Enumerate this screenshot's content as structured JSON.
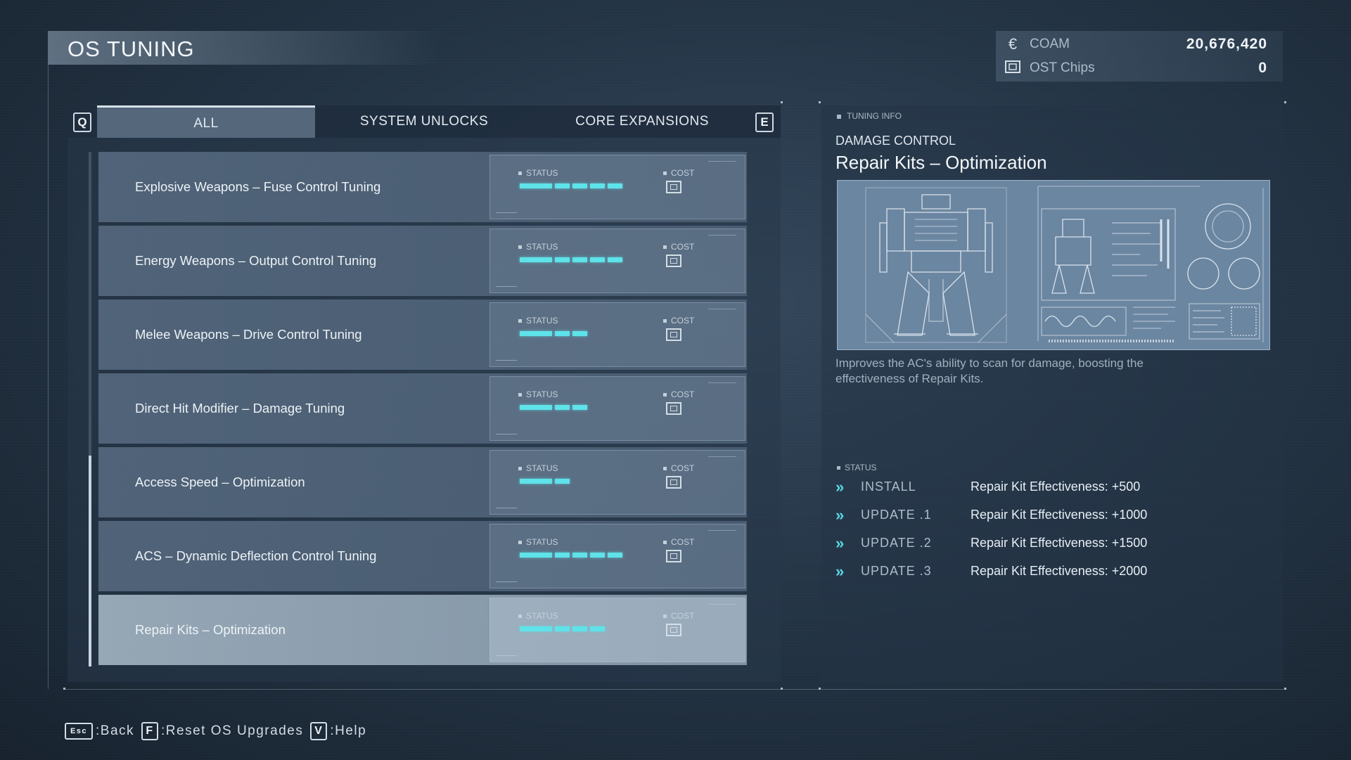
{
  "screen": {
    "title": "OS TUNING"
  },
  "currency": {
    "coam_label": "COAM",
    "coam_value": "20,676,420",
    "ost_label": "OST Chips",
    "ost_value": "0"
  },
  "tabs": {
    "prev_key": "Q",
    "next_key": "E",
    "items": [
      {
        "label": "ALL",
        "active": true
      },
      {
        "label": "SYSTEM UNLOCKS",
        "active": false
      },
      {
        "label": "CORE EXPANSIONS",
        "active": false
      }
    ]
  },
  "list": {
    "status_label": "STATUS",
    "cost_label": "COST",
    "items": [
      {
        "name": "Explosive Weapons – Fuse Control Tuning",
        "level": 4,
        "selected": false
      },
      {
        "name": "Energy Weapons – Output Control Tuning",
        "level": 4,
        "selected": false
      },
      {
        "name": "Melee Weapons – Drive Control Tuning",
        "level": 2,
        "selected": false
      },
      {
        "name": "Direct Hit Modifier – Damage Tuning",
        "level": 2,
        "selected": false
      },
      {
        "name": "Access Speed – Optimization",
        "level": 1,
        "selected": false
      },
      {
        "name": "ACS – Dynamic Deflection Control Tuning",
        "level": 4,
        "selected": false
      },
      {
        "name": "Repair Kits – Optimization",
        "level": 3,
        "selected": true
      }
    ]
  },
  "tuning_info": {
    "header": "TUNING INFO",
    "category": "DAMAGE CONTROL",
    "title": "Repair Kits – Optimization",
    "description": "Improves the AC's ability to scan for damage, boosting the effectiveness of Repair Kits.",
    "status_label": "STATUS",
    "updates": [
      {
        "level": "INSTALL",
        "effect": "Repair Kit Effectiveness: +500"
      },
      {
        "level": "UPDATE .1",
        "effect": "Repair Kit Effectiveness: +1000"
      },
      {
        "level": "UPDATE .2",
        "effect": "Repair Kit Effectiveness: +1500"
      },
      {
        "level": "UPDATE .3",
        "effect": "Repair Kit Effectiveness: +2000"
      }
    ]
  },
  "footer": {
    "back_key": "Esc",
    "back_label": ":Back",
    "reset_key": "F",
    "reset_label": ":Reset OS Upgrades",
    "help_key": "V",
    "help_label": ":Help"
  },
  "colors": {
    "accent": "#5fe3ea",
    "panel": "#2c3d50",
    "selected_row": "#aabccb"
  }
}
